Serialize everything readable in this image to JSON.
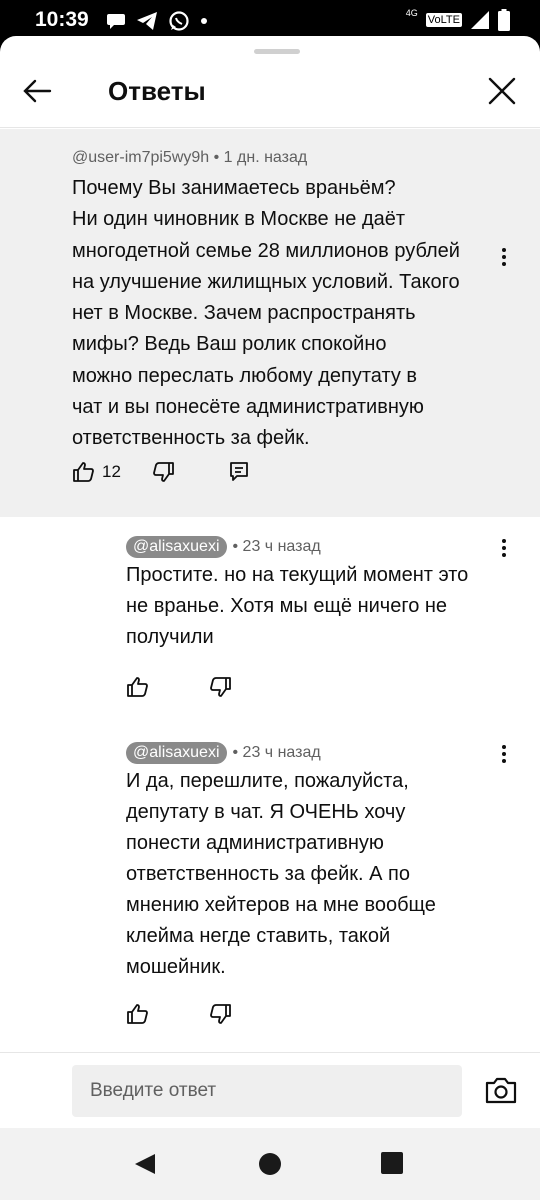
{
  "status_bar": {
    "time": "10:39",
    "notification_icons": [
      "chat-bubble-icon",
      "telegram-icon",
      "whatsapp-icon",
      "dot-icon"
    ],
    "network_label": "4G",
    "volte_label": "VoLTE",
    "system_icons": [
      "signal-icon",
      "battery-icon"
    ]
  },
  "header": {
    "title": "Ответы",
    "back_icon": "arrow-left-icon",
    "close_icon": "close-icon"
  },
  "parent_comment": {
    "author": "@user-im7pi5wy9h",
    "time": "1 дн. назад",
    "meta": "@user-im7pi5wy9h • 1 дн. назад",
    "text": "Почему Вы занимаетесь враньём?\nНи один чиновник в Москве не даёт\nмногодетной семье 28 миллионов рублей\nна улучшение  жилищных условий. Такого\nнет в Москве. Зачем распространять\nмифы? Ведь Ваш ролик спокойно\nможно переслать любому депутату в\nчат и вы понесёте административную\nответственность за фейк.",
    "likes": "12"
  },
  "replies": [
    {
      "author": "@alisaxuexi",
      "time": "• 23 ч назад",
      "text": "Простите. но на текущий момент это\nне вранье. Хотя мы ещё ничего не\nполучили"
    },
    {
      "author": "@alisaxuexi",
      "time": "• 23 ч назад",
      "text": "И да, перешлите, пожалуйста,\nдепутату в чат. Я ОЧЕНЬ хочу\nпонести административную\nответственность за фейк. А по\nмнению хейтеров на мне вообще\nклейма негде ставить, такой\nмошейник."
    }
  ],
  "composer": {
    "placeholder": "Введите ответ",
    "camera_icon": "camera-icon"
  },
  "navigation_bar": {
    "buttons": [
      "back-triangle-icon",
      "home-circle-icon",
      "recents-square-icon"
    ]
  }
}
